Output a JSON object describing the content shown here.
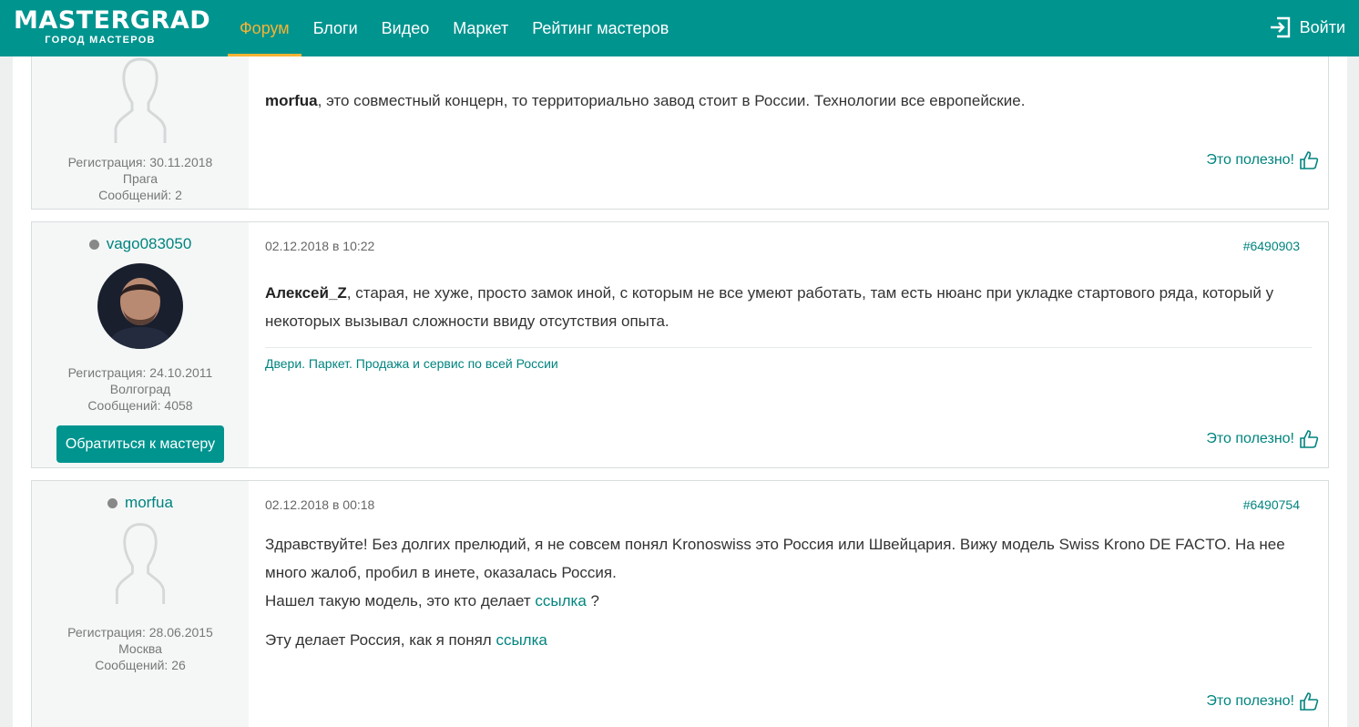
{
  "header": {
    "logo_main": "MASTERGRAD",
    "logo_sub": "ГОРОД МАСТЕРОВ",
    "nav": [
      "Форум",
      "Блоги",
      "Видео",
      "Маркет",
      "Рейтинг мастеров"
    ],
    "active_nav": "Форум",
    "login_label": "Войти",
    "brand_color": "#00948f",
    "accent_color": "#f5b335"
  },
  "posts": [
    {
      "reg": "Регистрация: 30.11.2018",
      "city": "Прага",
      "messages": "Сообщений: 2",
      "text_bold": "morfua",
      "text_rest": ", это совместный концерн, то территориально завод стоит в России. Технологии все европейские.",
      "useful": "Это полезно!"
    },
    {
      "author": "vago083050",
      "date": "02.12.2018 в 10:22",
      "number": "#6490903",
      "reg": "Регистрация: 24.10.2011",
      "city": "Волгоград",
      "messages": "Сообщений: 4058",
      "button": "Обратиться к мастеру",
      "text_bold": "Алексей_Z",
      "text_rest": ", старая, не хуже, просто замок иной, с которым не все умеют работать, там есть нюанс при укладке стартового ряда, который у некоторых вызывал сложности ввиду отсутствия опыта.",
      "signature": "Двери. Паркет. Продажа и сервис по всей России",
      "useful": "Это полезно!"
    },
    {
      "author": "morfua",
      "date": "02.12.2018 в 00:18",
      "number": "#6490754",
      "reg": "Регистрация: 28.06.2015",
      "city": "Москва",
      "messages": "Сообщений: 26",
      "para1": "Здравствуйте! Без долгих прелюдий, я не совсем понял Kronoswiss это Россия или Швейцария. Вижу модель Swiss Krono DE FACTO. На нее много жалоб, пробил в инете, оказалась Россия.",
      "para2_text": "Нашел такую модель, это кто делает ",
      "para2_link": "ссылка",
      "para2_end": " ?",
      "para3_text": "Эту делает Россия, как я понял ",
      "para3_link": "ссылка",
      "useful": "Это полезно!"
    }
  ]
}
